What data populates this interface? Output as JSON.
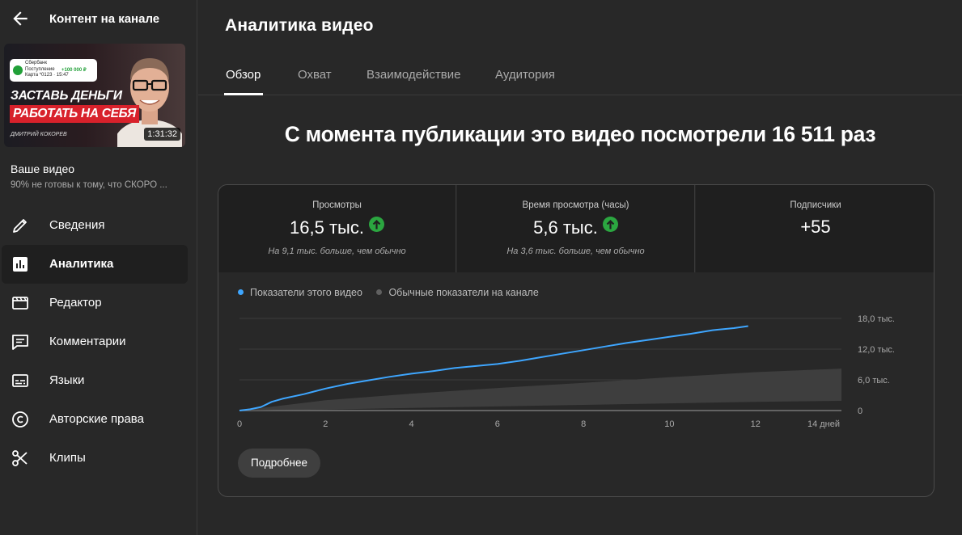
{
  "sidebar": {
    "title": "Контент на канале",
    "thumbnail": {
      "notification_lines": "Сбербанк\nПоступление\nКарта *0123 · 15:47",
      "notification_amount": "+100 000 ₽",
      "line1": "ЗАСТАВЬ ДЕНЬГИ",
      "line2": "РАБОТАТЬ НА СЕБЯ",
      "author": "ДМИТРИЙ КОКОРЕВ",
      "duration": "1:31:32"
    },
    "video_label": "Ваше видео",
    "video_desc": "90% не готовы к тому, что СКОРО ...",
    "items": [
      {
        "label": "Сведения",
        "icon": "pencil-icon",
        "active": false
      },
      {
        "label": "Аналитика",
        "icon": "analytics-icon",
        "active": true
      },
      {
        "label": "Редактор",
        "icon": "editor-icon",
        "active": false
      },
      {
        "label": "Комментарии",
        "icon": "comments-icon",
        "active": false
      },
      {
        "label": "Языки",
        "icon": "subtitles-icon",
        "active": false
      },
      {
        "label": "Авторские права",
        "icon": "copyright-icon",
        "active": false
      },
      {
        "label": "Клипы",
        "icon": "scissors-icon",
        "active": false
      }
    ]
  },
  "main": {
    "title": "Аналитика видео",
    "tabs": [
      {
        "label": "Обзор",
        "active": true
      },
      {
        "label": "Охват",
        "active": false
      },
      {
        "label": "Взаимодействие",
        "active": false
      },
      {
        "label": "Аудитория",
        "active": false
      }
    ],
    "headline": "С момента публикации это видео посмотрели 16 511 раз",
    "metrics": [
      {
        "label": "Просмотры",
        "value": "16,5 тыс.",
        "trend": "up",
        "note": "На 9,1 тыс. больше, чем обычно"
      },
      {
        "label": "Время просмотра (часы)",
        "value": "5,6 тыс.",
        "trend": "up",
        "note": "На 3,6 тыс. больше, чем обычно"
      },
      {
        "label": "Подписчики",
        "value": "+55",
        "trend": "",
        "note": ""
      }
    ],
    "more_button": "Подробнее"
  },
  "colors": {
    "accent_series": "#3ea6ff",
    "typical_series": "#606060",
    "trend_up": "#2ba640",
    "thumbnail_banner": "#d8212b"
  },
  "chart_data": {
    "type": "area",
    "legend": [
      "Показатели этого видео",
      "Обычные показатели на канале"
    ],
    "x_ticks": [
      "0",
      "2",
      "4",
      "6",
      "8",
      "10",
      "12",
      "14 дней"
    ],
    "y_ticks": [
      "18,0 тыс.",
      "12,0 тыс.",
      "6,0 тыс.",
      "0"
    ],
    "xlim": [
      0,
      14
    ],
    "ylim": [
      0,
      18000
    ],
    "grid": true,
    "series": [
      {
        "name": "Показатели этого видео",
        "x": [
          0,
          0.25,
          0.5,
          0.75,
          1,
          1.5,
          2,
          2.5,
          3,
          3.5,
          4,
          4.5,
          5,
          5.5,
          6,
          6.5,
          7,
          7.5,
          8,
          8.5,
          9,
          9.5,
          10,
          10.5,
          11,
          11.5,
          11.83
        ],
        "y": [
          0,
          250,
          700,
          1700,
          2300,
          3200,
          4300,
          5200,
          5900,
          6600,
          7200,
          7700,
          8300,
          8700,
          9100,
          9700,
          10400,
          11100,
          11800,
          12500,
          13200,
          13800,
          14400,
          15000,
          15700,
          16100,
          16500
        ]
      },
      {
        "name": "Обычные показатели на канале",
        "band": true,
        "x": [
          0,
          2,
          4,
          6,
          8,
          10,
          12,
          14
        ],
        "upper": [
          0,
          2000,
          3300,
          4400,
          5400,
          6500,
          7500,
          8200
        ],
        "lower": [
          0,
          200,
          500,
          800,
          1100,
          1400,
          1700,
          1900
        ]
      }
    ]
  }
}
